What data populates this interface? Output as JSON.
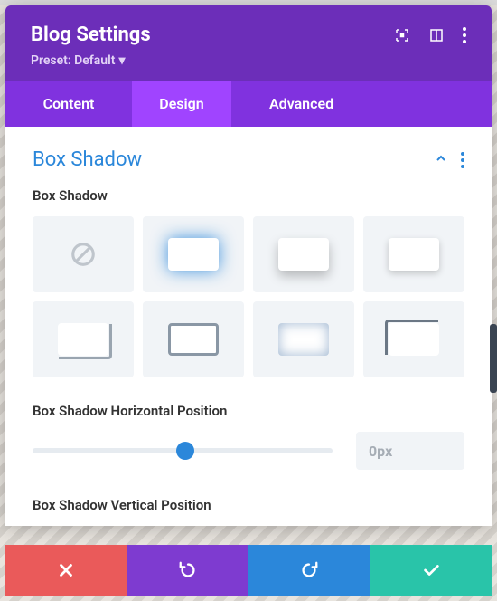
{
  "header": {
    "title": "Blog Settings",
    "preset_label": "Preset: Default"
  },
  "tabs": {
    "content": "Content",
    "design": "Design",
    "advanced": "Advanced"
  },
  "section": {
    "title": "Box Shadow",
    "field_label": "Box Shadow"
  },
  "horiz": {
    "label": "Box Shadow Horizontal Position",
    "value": "0px"
  },
  "vert": {
    "label": "Box Shadow Vertical Position"
  }
}
